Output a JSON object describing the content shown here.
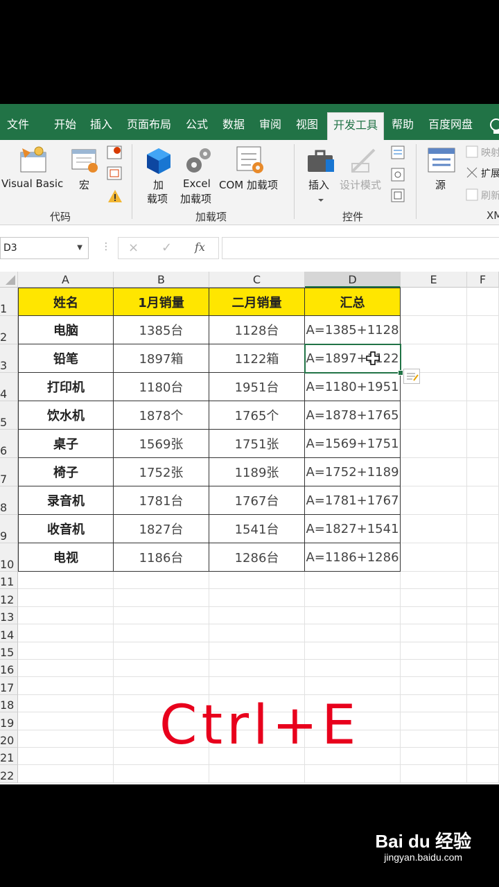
{
  "ribbon": {
    "tabs": [
      "文件",
      "开始",
      "插入",
      "页面布局",
      "公式",
      "数据",
      "审阅",
      "视图",
      "开发工具",
      "帮助",
      "百度网盘"
    ],
    "active_tab": "开发工具",
    "groups": {
      "code": {
        "label": "代码",
        "visual_basic": "Visual Basic",
        "macro": "宏"
      },
      "addins": {
        "label": "加载项",
        "addin_line1": "加",
        "addin_line2": "载项",
        "excel_line1": "Excel",
        "excel_line2": "加载项",
        "com": "COM 加载项"
      },
      "controls": {
        "label": "控件",
        "insert": "插入",
        "design": "设计模式"
      },
      "xml": {
        "label": "XM",
        "source": "源",
        "map": "映射",
        "expand": "扩展",
        "refresh": "刷新"
      }
    }
  },
  "formula_bar": {
    "name_box": "D3",
    "fx": "fx",
    "cancel": "×",
    "enter": "✓",
    "formula": ""
  },
  "sheet": {
    "columns": [
      "A",
      "B",
      "C",
      "D",
      "E",
      "F"
    ],
    "rows": [
      "1",
      "2",
      "3",
      "4",
      "5",
      "6",
      "7",
      "8",
      "9",
      "10",
      "11",
      "12",
      "13",
      "14",
      "15",
      "16",
      "17",
      "18",
      "19",
      "20",
      "21",
      "22"
    ],
    "selected_cell": "D3",
    "header": [
      "姓名",
      "1月销量",
      "二月销量",
      "汇总"
    ],
    "data": [
      [
        "电脑",
        "1385台",
        "1128台",
        "A=1385+1128"
      ],
      [
        "铅笔",
        "1897箱",
        "1122箱",
        "A=1897+1122"
      ],
      [
        "打印机",
        "1180台",
        "1951台",
        "A=1180+1951"
      ],
      [
        "饮水机",
        "1878个",
        "1765个",
        "A=1878+1765"
      ],
      [
        "桌子",
        "1569张",
        "1751张",
        "A=1569+1751"
      ],
      [
        "椅子",
        "1752张",
        "1189张",
        "A=1752+1189"
      ],
      [
        "录音机",
        "1781台",
        "1767台",
        "A=1781+1767"
      ],
      [
        "收音机",
        "1827台",
        "1541台",
        "A=1827+1541"
      ],
      [
        "电视",
        "1186台",
        "1286台",
        "A=1186+1286"
      ]
    ]
  },
  "overlay": {
    "shortcut": "Ctrl+E"
  },
  "watermark": {
    "brand": "Bai du 经验",
    "url": "jingyan.baidu.com"
  },
  "colors": {
    "excel_green": "#217346",
    "header_yellow": "#ffe600",
    "shortcut_red": "#e8001c"
  }
}
